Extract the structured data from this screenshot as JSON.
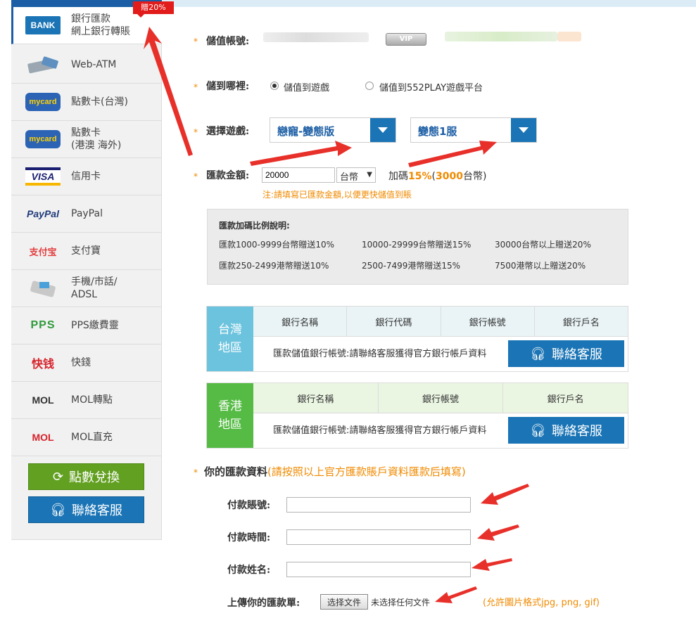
{
  "sidebar": {
    "items": [
      {
        "label": "銀行匯款\n網上銀行轉賬",
        "logo": "BANK",
        "logo_icon": "bank-card-icon"
      },
      {
        "label": "Web-ATM",
        "logo": "",
        "logo_icon": "atm-card-reader-icon"
      },
      {
        "label": "點數卡(台灣)",
        "logo": "mycard",
        "logo_icon": "mycard-logo-icon"
      },
      {
        "label": "點數卡\n(港澳 海外)",
        "logo": "mycard",
        "logo_icon": "mycard-logo-icon"
      },
      {
        "label": "信用卡",
        "logo": "VISA",
        "logo_icon": "visa-logo-icon"
      },
      {
        "label": "PayPal",
        "logo": "PayPal",
        "logo_icon": "paypal-logo-icon"
      },
      {
        "label": "支付寶",
        "logo": "支付宝",
        "logo_icon": "alipay-logo-icon"
      },
      {
        "label": "手機/市話/\nADSL",
        "logo": "",
        "logo_icon": "phone-icon"
      },
      {
        "label": "PPS繳費靈",
        "logo": "PPS",
        "logo_icon": "pps-logo-icon"
      },
      {
        "label": "快錢",
        "logo": "快钱",
        "logo_icon": "99bill-logo-icon"
      },
      {
        "label": "MOL轉點",
        "logo": "MOL",
        "logo_icon": "mol-points-logo-icon"
      },
      {
        "label": "MOL直充",
        "logo": "MOL",
        "logo_icon": "mol-direct-logo-icon"
      }
    ],
    "badge": "贈20%",
    "exchange_button": "點數兌換",
    "contact_button": "聯絡客服"
  },
  "form": {
    "account_label": "儲值帳號:",
    "vip_label": "VIP",
    "target_label": "儲到哪裡:",
    "target_options": [
      "儲值到遊戲",
      "儲值到552PLAY遊戲平台"
    ],
    "game_label": "選擇遊戲:",
    "game_value": "戀寵-變態版",
    "server_value": "變態1服",
    "amount_label": "匯款金額:",
    "amount_value": "20000",
    "currency_value": "台幣",
    "bonus_prefix": "加碼",
    "bonus_percent": "15%",
    "bonus_open": "(",
    "bonus_amount": "3000",
    "bonus_suffix": "台幣)",
    "amount_note": "注:請填寫已匯款金額,以便更快儲值到賬"
  },
  "rates": {
    "title": "匯款加碼比例說明:",
    "rows": [
      [
        "匯款1000-9999台幣贈送10%",
        "10000-29999台幣贈送15%",
        "30000台幣以上贈送20%"
      ],
      [
        "匯款250-2499港幣贈送10%",
        "2500-7499港幣贈送15%",
        "7500港幣以上贈送20%"
      ]
    ]
  },
  "taiwan": {
    "region": "台灣\n地區",
    "headers": [
      "銀行名稱",
      "銀行代碼",
      "銀行帳號",
      "銀行戶名"
    ],
    "text": "匯款儲值銀行帳號:請聯絡客服獲得官方銀行帳戶資料",
    "button": "聯絡客服"
  },
  "hongkong": {
    "region": "香港\n地區",
    "headers": [
      "銀行名稱",
      "銀行帳號",
      "銀行戶名"
    ],
    "text": "匯款儲值銀行帳號:請聯絡客服獲得官方銀行帳戶資料",
    "button": "聯絡客服"
  },
  "payment": {
    "title": "你的匯款資料",
    "hint": "(請按照以上官方匯款賬戶資料匯款后填寫)",
    "account_label": "付款賬號:",
    "time_label": "付款時間:",
    "name_label": "付款姓名:",
    "upload_label": "上傳你的匯款單:",
    "file_button": "选择文件",
    "file_none": "未选择任何文件",
    "file_hint": "(允許圖片格式jpg, png, gif)"
  },
  "colors": {
    "brand_blue": "#1a74b5",
    "accent_orange": "#f08a00",
    "taiwan_region": "#6bc3de",
    "hongkong_region": "#55bb44",
    "annotation_red": "#e8302a"
  }
}
